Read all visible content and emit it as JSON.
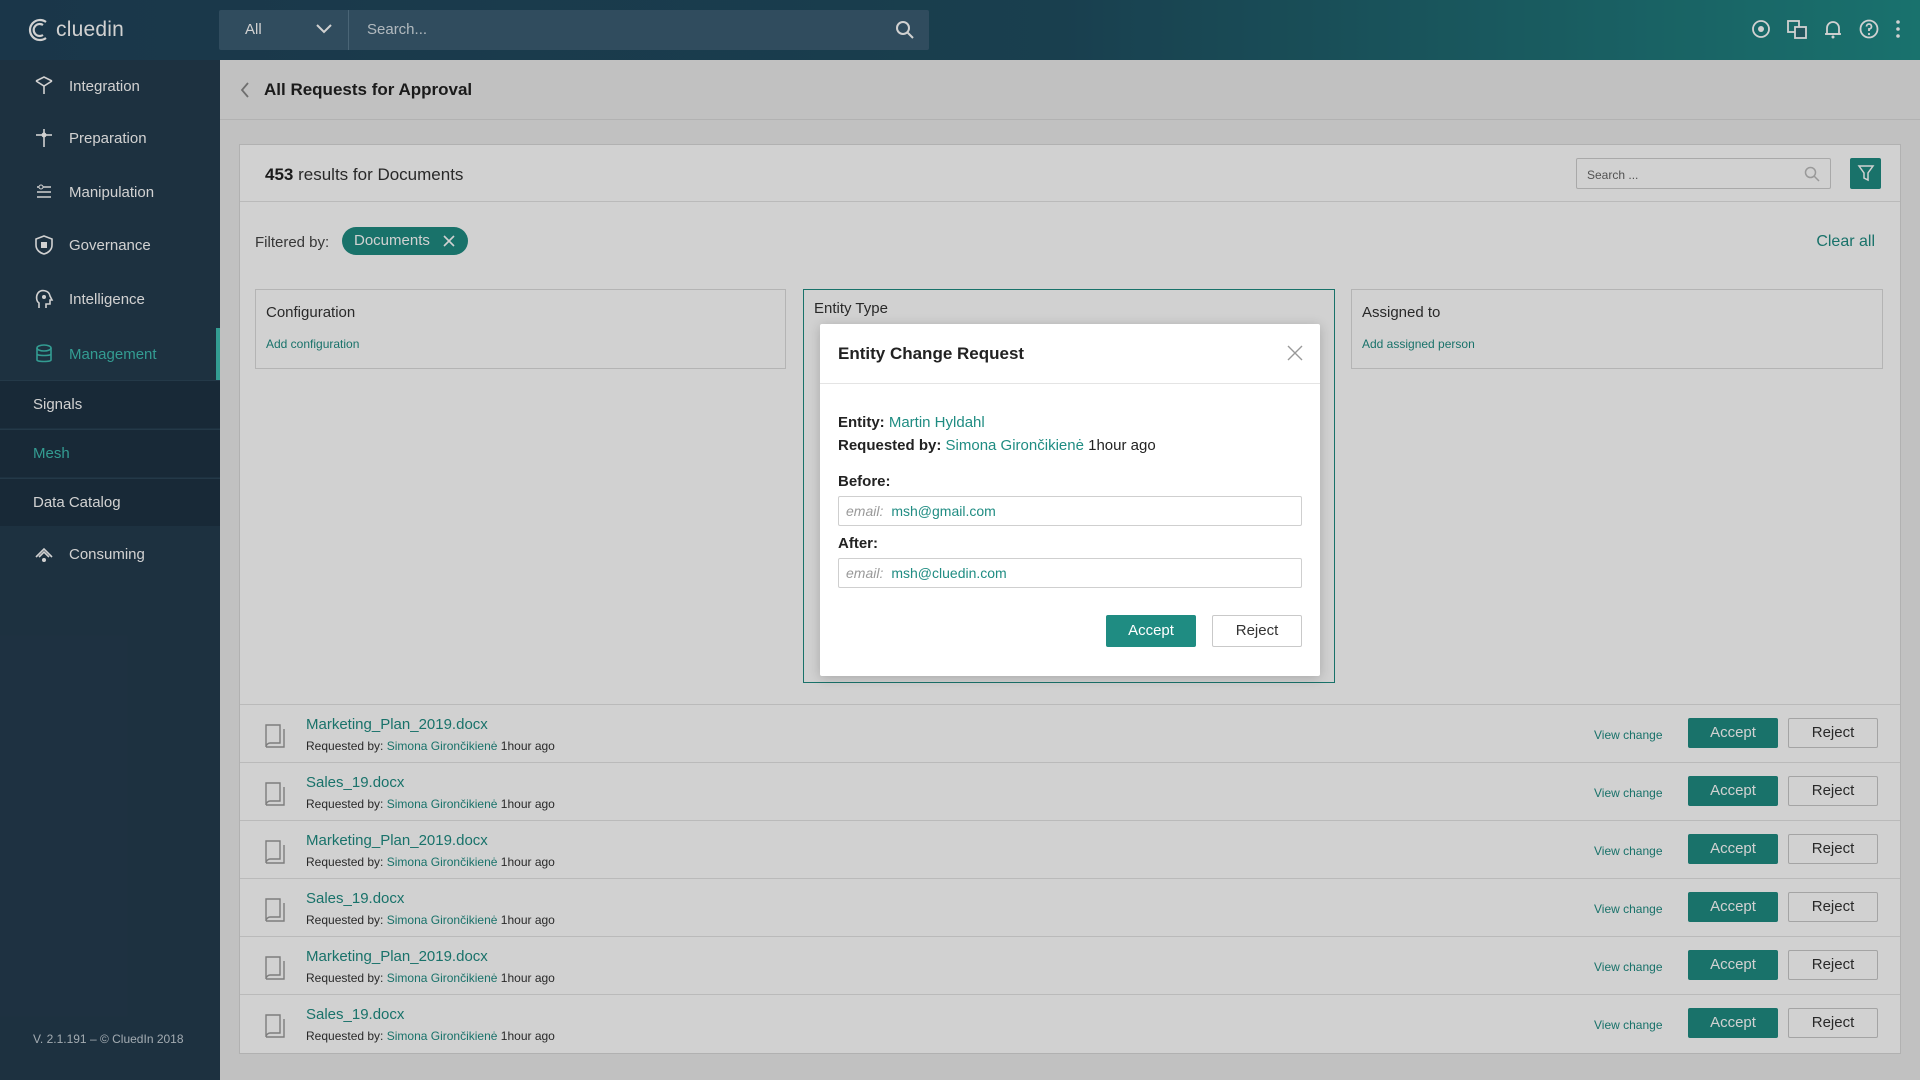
{
  "app": {
    "logo_text": "cluedin",
    "version": "V. 2.1.191 – © CluedIn  2018"
  },
  "search": {
    "scope": "All",
    "placeholder": "Search..."
  },
  "top_icons": [
    "status-eye-icon",
    "translate-icon",
    "bell-icon",
    "help-icon",
    "more-vertical-icon"
  ],
  "sidebar": {
    "items": [
      {
        "label": "Integration",
        "icon": "integration-icon"
      },
      {
        "label": "Preparation",
        "icon": "preparation-icon"
      },
      {
        "label": "Manipulation",
        "icon": "manipulation-icon"
      },
      {
        "label": "Governance",
        "icon": "governance-shield-icon"
      },
      {
        "label": "Intelligence",
        "icon": "intelligence-head-icon"
      },
      {
        "label": "Management",
        "icon": "management-database-icon",
        "active": true
      }
    ],
    "subitems": [
      {
        "label": "Signals"
      },
      {
        "label": "Mesh",
        "active": true
      },
      {
        "label": "Data Catalog"
      }
    ],
    "after": [
      {
        "label": "Consuming",
        "icon": "consuming-icon"
      }
    ]
  },
  "page": {
    "title": "All Requests for Approval"
  },
  "results": {
    "count": "453",
    "suffix": " results for Documents",
    "search_placeholder": "Search ..."
  },
  "filters": {
    "label": "Filtered by:",
    "chip": "Documents",
    "clear_all": "Clear all",
    "boxes": [
      {
        "title": "Configuration",
        "link": "Add configuration"
      },
      {
        "title": "Entity Type",
        "link": ""
      },
      {
        "title": "Assigned to",
        "link": "Add assigned person"
      }
    ]
  },
  "rows": [
    {
      "name": "Marketing_Plan_2019.docx",
      "by_label": "Requested by:",
      "person": "Simona Girončikienė",
      "time": "1hour ago",
      "view": "View change",
      "accept": "Accept",
      "reject": "Reject"
    },
    {
      "name": "Sales_19.docx",
      "by_label": "Requested by:",
      "person": "Simona Girončikienė",
      "time": "1hour ago",
      "view": "View change",
      "accept": "Accept",
      "reject": "Reject"
    },
    {
      "name": "Marketing_Plan_2019.docx",
      "by_label": "Requested by:",
      "person": "Simona Girončikienė",
      "time": "1hour ago",
      "view": "View change",
      "accept": "Accept",
      "reject": "Reject"
    },
    {
      "name": "Sales_19.docx",
      "by_label": "Requested by:",
      "person": "Simona Girončikienė",
      "time": "1hour ago",
      "view": "View change",
      "accept": "Accept",
      "reject": "Reject"
    },
    {
      "name": "Marketing_Plan_2019.docx",
      "by_label": "Requested by:",
      "person": "Simona Girončikienė",
      "time": "1hour ago",
      "view": "View change",
      "accept": "Accept",
      "reject": "Reject"
    },
    {
      "name": "Sales_19.docx",
      "by_label": "Requested by:",
      "person": "Simona Girončikienė",
      "time": "1hour ago",
      "view": "View change",
      "accept": "Accept",
      "reject": "Reject"
    }
  ],
  "modal": {
    "title": "Entity Change Request",
    "entity_label": "Entity:",
    "entity": "Martin Hyldahl",
    "requested_label": "Requested by:",
    "requested_by": "Simona Girončikienė",
    "requested_time": "1hour ago",
    "before_label": "Before:",
    "before_field": "email:",
    "before_value": "msh@gmail.com",
    "after_label": "After:",
    "after_field": "email:",
    "after_value": "msh@cluedin.com",
    "accept": "Accept",
    "reject": "Reject"
  },
  "colors": {
    "accent": "#1f8c82",
    "sidebar": "#243c4f",
    "active_nav": "#3fbfb2"
  }
}
